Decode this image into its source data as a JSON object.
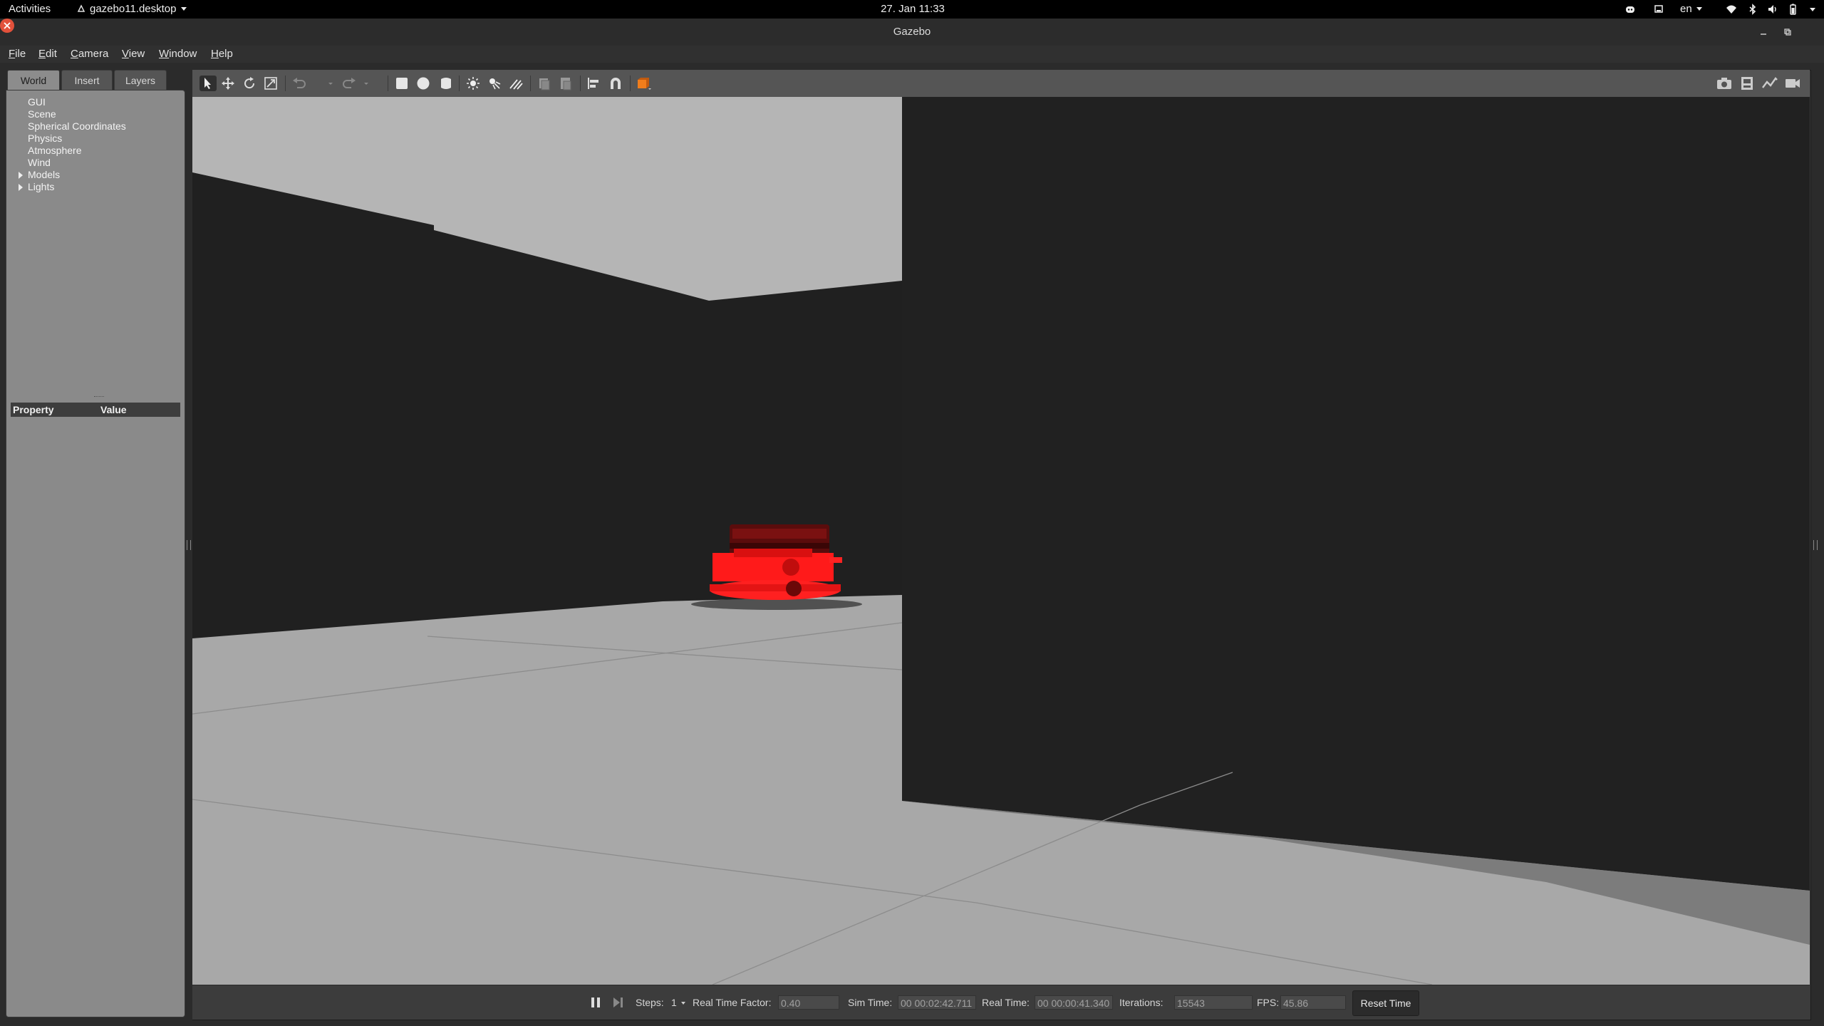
{
  "topbar": {
    "activities": "Activities",
    "app_menu": "gazebo11.desktop",
    "clock": "27. Jan  11:33",
    "keyboard_layout": "en",
    "tray_icons": [
      "discord-icon",
      "screen-share-icon",
      "wifi-icon",
      "bluetooth-icon",
      "volume-icon",
      "battery-icon",
      "power-menu-icon"
    ]
  },
  "window": {
    "title": "Gazebo",
    "controls": [
      "minimize-icon",
      "maximize-icon",
      "close-icon"
    ]
  },
  "menubar": {
    "items": [
      {
        "label": "File",
        "mnemonic": "F",
        "rest": "ile"
      },
      {
        "label": "Edit",
        "mnemonic": "E",
        "rest": "dit"
      },
      {
        "label": "Camera",
        "mnemonic": "C",
        "rest": "amera"
      },
      {
        "label": "View",
        "mnemonic": "V",
        "rest": "iew"
      },
      {
        "label": "Window",
        "mnemonic": "W",
        "rest": "indow"
      },
      {
        "label": "Help",
        "mnemonic": "H",
        "rest": "elp"
      }
    ]
  },
  "left_panel": {
    "tabs": [
      "World",
      "Insert",
      "Layers"
    ],
    "active_tab": "World",
    "tree": [
      "GUI",
      "Scene",
      "Spherical Coordinates",
      "Physics",
      "Atmosphere",
      "Wind",
      "Models",
      "Lights"
    ],
    "expandable": [
      "Models",
      "Lights"
    ],
    "property_header": {
      "property": "Property",
      "value": "Value"
    }
  },
  "toolbar": {
    "tools": [
      "select-mode-icon",
      "translate-mode-icon",
      "rotate-mode-icon",
      "scale-mode-icon",
      "undo-icon",
      "undo-history-icon",
      "redo-icon",
      "redo-history-icon",
      "box-shape-icon",
      "sphere-shape-icon",
      "cylinder-shape-icon",
      "point-light-icon",
      "spot-light-icon",
      "directional-light-icon",
      "copy-icon",
      "paste-icon",
      "align-icon",
      "snap-icon",
      "change-view-icon"
    ],
    "right_tools": [
      "screenshot-icon",
      "log-data-icon",
      "plot-icon",
      "record-video-icon"
    ]
  },
  "colors": {
    "robot": "#ff1a1a",
    "floor": "#a8a8a8",
    "wall": "#202020",
    "sky": "#b5b5b5"
  },
  "statusbar": {
    "steps_label": "Steps:",
    "steps_value": "1",
    "rtf_label": "Real Time Factor:",
    "rtf_value": "0.40",
    "sim_time_label": "Sim Time:",
    "sim_time_value": "00 00:02:42.711",
    "real_time_label": "Real Time:",
    "real_time_value": "00 00:00:41.340",
    "iterations_label": "Iterations:",
    "iterations_value": "15543",
    "fps_label": "FPS:",
    "fps_value": "45.86",
    "reset_button": "Reset Time"
  }
}
